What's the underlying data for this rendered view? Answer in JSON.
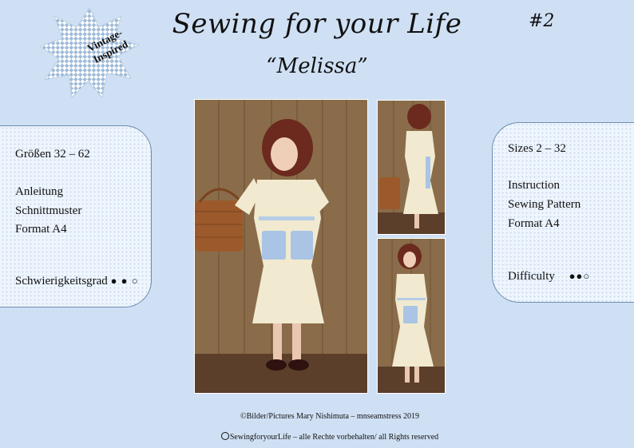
{
  "header": {
    "title": "Sewing for your Life",
    "subtitle": "“Melissa”",
    "issue_number": "#2"
  },
  "badge": {
    "line1": "Vintage-",
    "line2": "Inspired"
  },
  "left_panel": {
    "sizes": "Größen 32 – 62",
    "item1": "Anleitung",
    "item2": "Schnittmuster",
    "item3": "Format A4",
    "difficulty_label": "Schwierigkeitsgrad",
    "difficulty_dots": "● ● ○",
    "difficulty_level": "2 of 3"
  },
  "right_panel": {
    "sizes": "Sizes 2 – 32",
    "item1": "Instruction",
    "item2": "Sewing Pattern",
    "item3": "Format A4",
    "difficulty_label": "Difficulty",
    "difficulty_dots": "●●○",
    "difficulty_level": "2 of 3"
  },
  "footer": {
    "photo_credit": "©Bilder/Pictures Mary Nishimuta – mnseamstress 2019",
    "rights": "SewingforyourLife – alle Rechte vorbehalten/ all Rights reserved"
  },
  "colors": {
    "background": "#cfe0f4",
    "panel_fill": "#eef5fd",
    "panel_border": "#6d8bb0",
    "badge_check": "#9fbbd8",
    "dress": "#f1ead0",
    "pocket": "#a9c4e4"
  },
  "photos": {
    "main": "woman-in-floral-dress-with-picnic-basket-photo",
    "side_top": "woman-side-view-photo",
    "side_bottom": "woman-three-quarter-view-photo"
  }
}
